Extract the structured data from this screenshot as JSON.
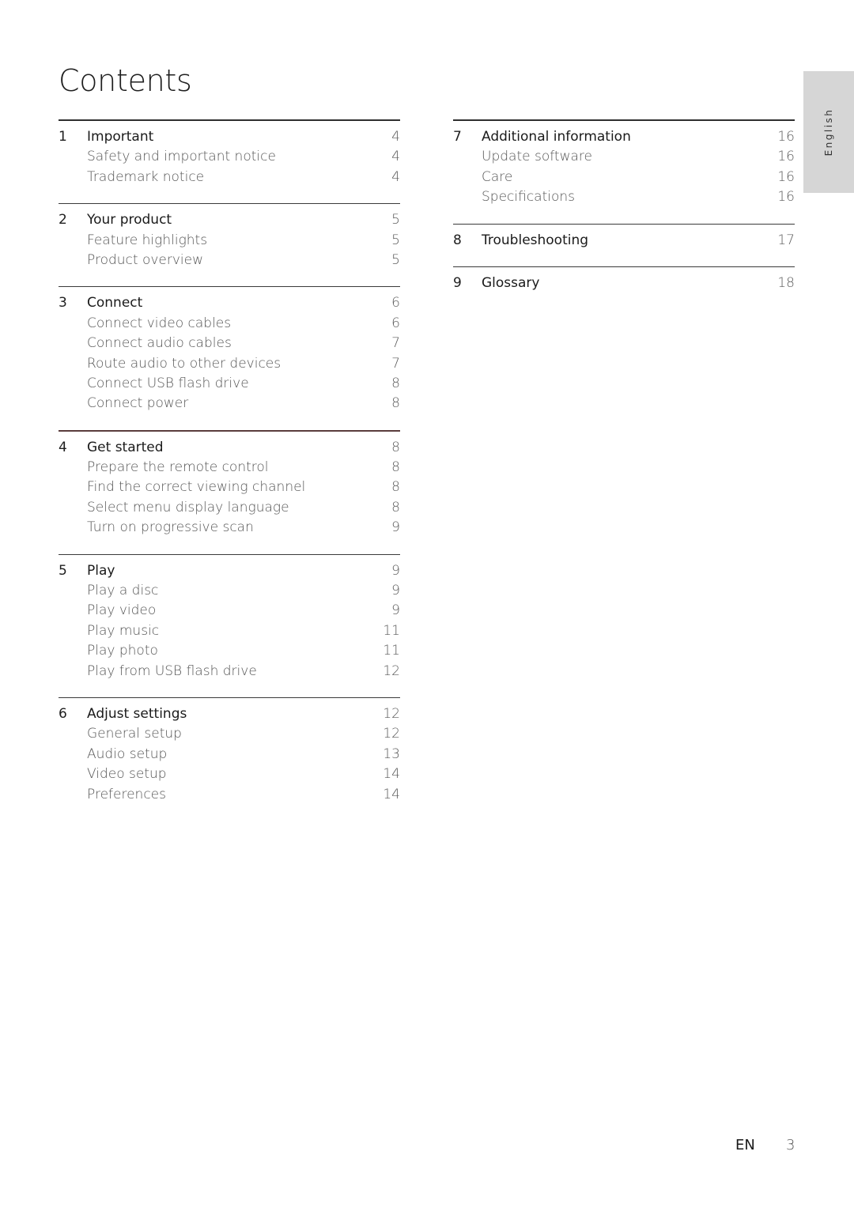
{
  "page": {
    "title": "Contents",
    "language_tab": "English",
    "footer": {
      "lang_code": "EN",
      "page_number": "3"
    }
  },
  "toc": {
    "left": [
      {
        "num": "1",
        "title": "Important",
        "page": "4",
        "items": [
          {
            "label": "Safety and important notice",
            "page": "4"
          },
          {
            "label": "Trademark notice",
            "page": "4"
          }
        ]
      },
      {
        "num": "2",
        "title": "Your product",
        "page": "5",
        "items": [
          {
            "label": "Feature highlights",
            "page": "5"
          },
          {
            "label": "Product overview",
            "page": "5"
          }
        ]
      },
      {
        "num": "3",
        "title": "Connect",
        "page": "6",
        "items": [
          {
            "label": "Connect video cables",
            "page": "6"
          },
          {
            "label": "Connect audio cables",
            "page": "7"
          },
          {
            "label": "Route audio to other devices",
            "page": "7"
          },
          {
            "label": "Connect USB flash drive",
            "page": "8"
          },
          {
            "label": "Connect power",
            "page": "8"
          }
        ]
      },
      {
        "num": "4",
        "title": "Get started",
        "page": "8",
        "items": [
          {
            "label": "Prepare the remote control",
            "page": "8"
          },
          {
            "label": "Find the correct viewing channel",
            "page": "8"
          },
          {
            "label": "Select menu display language",
            "page": "8"
          },
          {
            "label": "Turn on progressive scan",
            "page": "9"
          }
        ]
      },
      {
        "num": "5",
        "title": "Play",
        "page": "9",
        "items": [
          {
            "label": "Play a disc",
            "page": "9"
          },
          {
            "label": "Play video",
            "page": "9"
          },
          {
            "label": "Play music",
            "page": "11"
          },
          {
            "label": "Play photo",
            "page": "11"
          },
          {
            "label": "Play from USB flash drive",
            "page": "12"
          }
        ]
      },
      {
        "num": "6",
        "title": "Adjust settings",
        "page": "12",
        "items": [
          {
            "label": "General setup",
            "page": "12"
          },
          {
            "label": "Audio setup",
            "page": "13"
          },
          {
            "label": "Video setup",
            "page": "14"
          },
          {
            "label": "Preferences",
            "page": "14"
          }
        ]
      }
    ],
    "right": [
      {
        "num": "7",
        "title": "Additional information",
        "page": "16",
        "items": [
          {
            "label": "Update software",
            "page": "16"
          },
          {
            "label": "Care",
            "page": "16"
          },
          {
            "label": "Specifications",
            "page": "16"
          }
        ]
      },
      {
        "num": "8",
        "title": "Troubleshooting",
        "page": "17",
        "items": []
      },
      {
        "num": "9",
        "title": "Glossary",
        "page": "18",
        "items": []
      }
    ]
  }
}
